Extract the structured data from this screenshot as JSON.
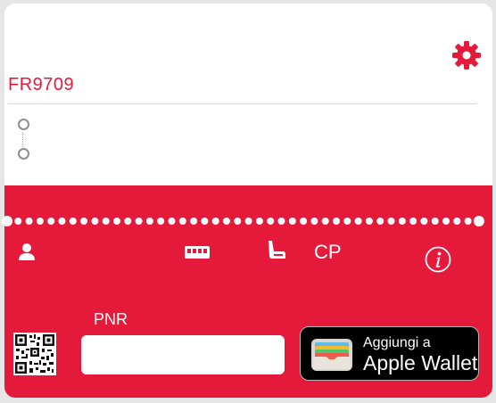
{
  "ticket": {
    "flight_number": "FR9709"
  },
  "details": {
    "seat_class": "CP"
  },
  "pnr": {
    "label": "PNR",
    "value": "",
    "placeholder": ""
  },
  "wallet_button": {
    "line1": "Aggiungi a",
    "line2": "Apple Wallet"
  },
  "colors": {
    "accent": "#e5193a",
    "background": "#ffffff",
    "wallet_bg": "#000000"
  },
  "icons": [
    "gear-icon",
    "passenger-icon",
    "ticket-icon",
    "seat-icon",
    "info-icon",
    "qr-code-icon",
    "wallet-icon"
  ]
}
